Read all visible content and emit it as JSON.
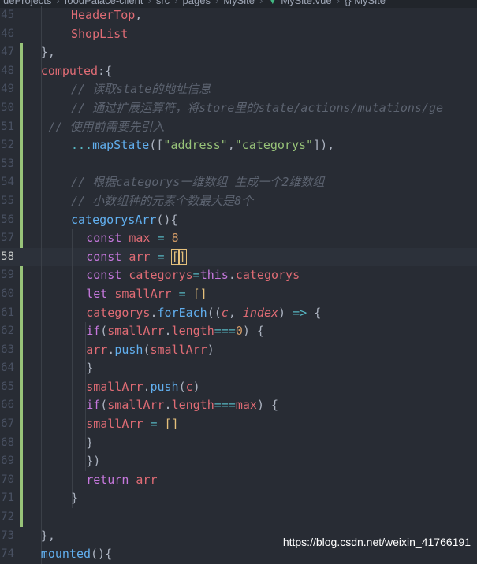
{
  "breadcrumb": {
    "items": [
      "ueProjects",
      "foodPalace-client",
      "src",
      "pages",
      "MySite",
      "MySite.vue",
      "{} MySite"
    ]
  },
  "editor": {
    "active_line": 58,
    "lines": [
      {
        "num": "45",
        "text": "HeaderTop,"
      },
      {
        "num": "46",
        "text": "ShopList"
      },
      {
        "num": "47",
        "text": "},"
      },
      {
        "num": "48",
        "text": "computed:{"
      },
      {
        "num": "49",
        "text": "// 读取state的地址信息"
      },
      {
        "num": "50",
        "text": "// 通过扩展运算符，将store里的state/actions/mutations/ge"
      },
      {
        "num": "51",
        "text": "// 使用前需要先引入"
      },
      {
        "num": "52",
        "text": "...mapState([\"address\",\"categorys\"]),"
      },
      {
        "num": "53",
        "text": ""
      },
      {
        "num": "54",
        "text": "// 根据categorys一维数组 生成一个2维数组"
      },
      {
        "num": "55",
        "text": "// 小数组种的元素个数最大是8个"
      },
      {
        "num": "56",
        "text": "categorysArr(){"
      },
      {
        "num": "57",
        "text": "const max = 8"
      },
      {
        "num": "58",
        "text": "const arr = []"
      },
      {
        "num": "59",
        "text": "const categorys=this.categorys"
      },
      {
        "num": "60",
        "text": "let smallArr = []"
      },
      {
        "num": "61",
        "text": "categorys.forEach((c, index) => {"
      },
      {
        "num": "62",
        "text": "if(smallArr.length===0) {"
      },
      {
        "num": "63",
        "text": "arr.push(smallArr)"
      },
      {
        "num": "64",
        "text": "}"
      },
      {
        "num": "65",
        "text": "smallArr.push(c)"
      },
      {
        "num": "66",
        "text": "if(smallArr.length===max) {"
      },
      {
        "num": "67",
        "text": "smallArr = []"
      },
      {
        "num": "68",
        "text": "}"
      },
      {
        "num": "69",
        "text": "})"
      },
      {
        "num": "70",
        "text": "return arr"
      },
      {
        "num": "71",
        "text": "}"
      },
      {
        "num": "72",
        "text": ""
      },
      {
        "num": "73",
        "text": "},"
      },
      {
        "num": "74",
        "text": "mounted(){"
      }
    ]
  },
  "watermark": "https://blog.csdn.net/weixin_41766191",
  "colors": {
    "background": "#282c34",
    "keyword": "#c678dd",
    "function": "#61afef",
    "string": "#98c379",
    "number": "#d19a66",
    "comment": "#5c6370",
    "variable": "#e06c75",
    "git_added": "#98c379"
  }
}
